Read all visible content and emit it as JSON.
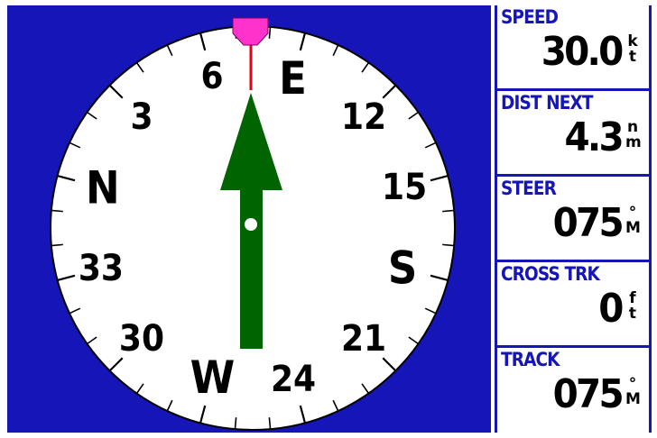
{
  "compass": {
    "card_labels": [
      "N",
      "3",
      "6",
      "E",
      "12",
      "15",
      "S",
      "21",
      "24",
      "W",
      "30",
      "33"
    ],
    "colors": {
      "background": "#1515b8",
      "dial": "#ffffff",
      "arrow": "#006400",
      "lubber": "#e0001a",
      "bug": "#ff33cc"
    }
  },
  "fields": {
    "speed": {
      "label": "SPEED",
      "value": "30.0",
      "unit_top": "k",
      "unit_bottom": "t"
    },
    "dist_next": {
      "label": "DIST NEXT",
      "value": "4.3",
      "unit_top": "n",
      "unit_bottom": "m"
    },
    "steer": {
      "label": "STEER",
      "value": "075",
      "unit_top": "°",
      "unit_bottom": "M"
    },
    "cross_trk": {
      "label": "CROSS TRK",
      "value": "0",
      "unit_top": "f",
      "unit_bottom": "t"
    },
    "track": {
      "label": "TRACK",
      "value": "075",
      "unit_top": "°",
      "unit_bottom": "M"
    }
  }
}
